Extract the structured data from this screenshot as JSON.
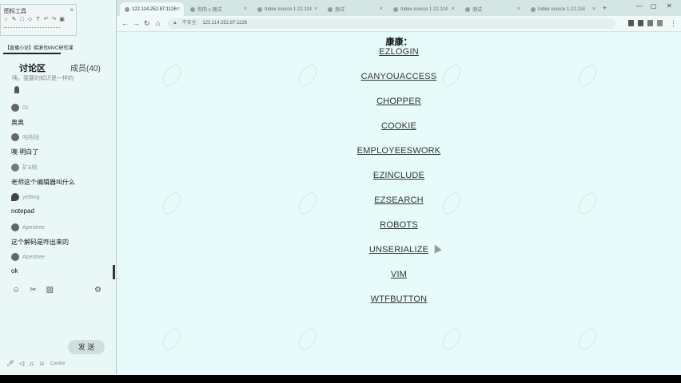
{
  "toolwindow": {
    "title": "图标工具",
    "icons": [
      "ellipse-icon",
      "pencil-icon",
      "square-icon",
      "shape-icon",
      "text-icon",
      "undo-icon",
      "redo-icon",
      "save-icon"
    ]
  },
  "chat": {
    "course_title": "【直播小论】摇滚也MVC研究课",
    "tab_discuss": "讨论区",
    "tab_members": "成员(40)",
    "pinned_text": "咦，我要的知识是一样的",
    "messages": [
      {
        "name": "01",
        "text": "奥奥"
      },
      {
        "name": "咕咕哒",
        "text": "噢 明白了"
      },
      {
        "name": "矿&哟",
        "text": "老师这个编辑器叫什么"
      },
      {
        "name": "yeBing",
        "text": "notepad"
      },
      {
        "name": "Apestree",
        "text": "这个解码是咋出来的"
      },
      {
        "name": "Apestree",
        "text": "ok"
      }
    ],
    "send_label": "发 送",
    "bottom_sub": "Cookie"
  },
  "browser": {
    "tabs": [
      {
        "label": "122.114.252.87:1126",
        "active": true
      },
      {
        "label": "你的 s 测试",
        "active": false
      },
      {
        "label": "Index source 1.22.114",
        "active": false
      },
      {
        "label": "测试",
        "active": false
      },
      {
        "label": "Index source 1.22.114",
        "active": false
      },
      {
        "label": "测试",
        "active": false
      },
      {
        "label": "Index source 1.22.114",
        "active": false
      }
    ],
    "insecure_label": "不安全",
    "url": "122.114.252.87:1126"
  },
  "page": {
    "title": "康康：",
    "links": [
      "EZLOGIN",
      "CANYOUACCESS",
      "CHOPPER",
      "COOKIE",
      "EMPLOYEESWORK",
      "EZINCLUDE",
      "EZSEARCH",
      "ROBOTS",
      "UNSERIALIZE",
      "VIM",
      "WTFBUTTON"
    ]
  }
}
